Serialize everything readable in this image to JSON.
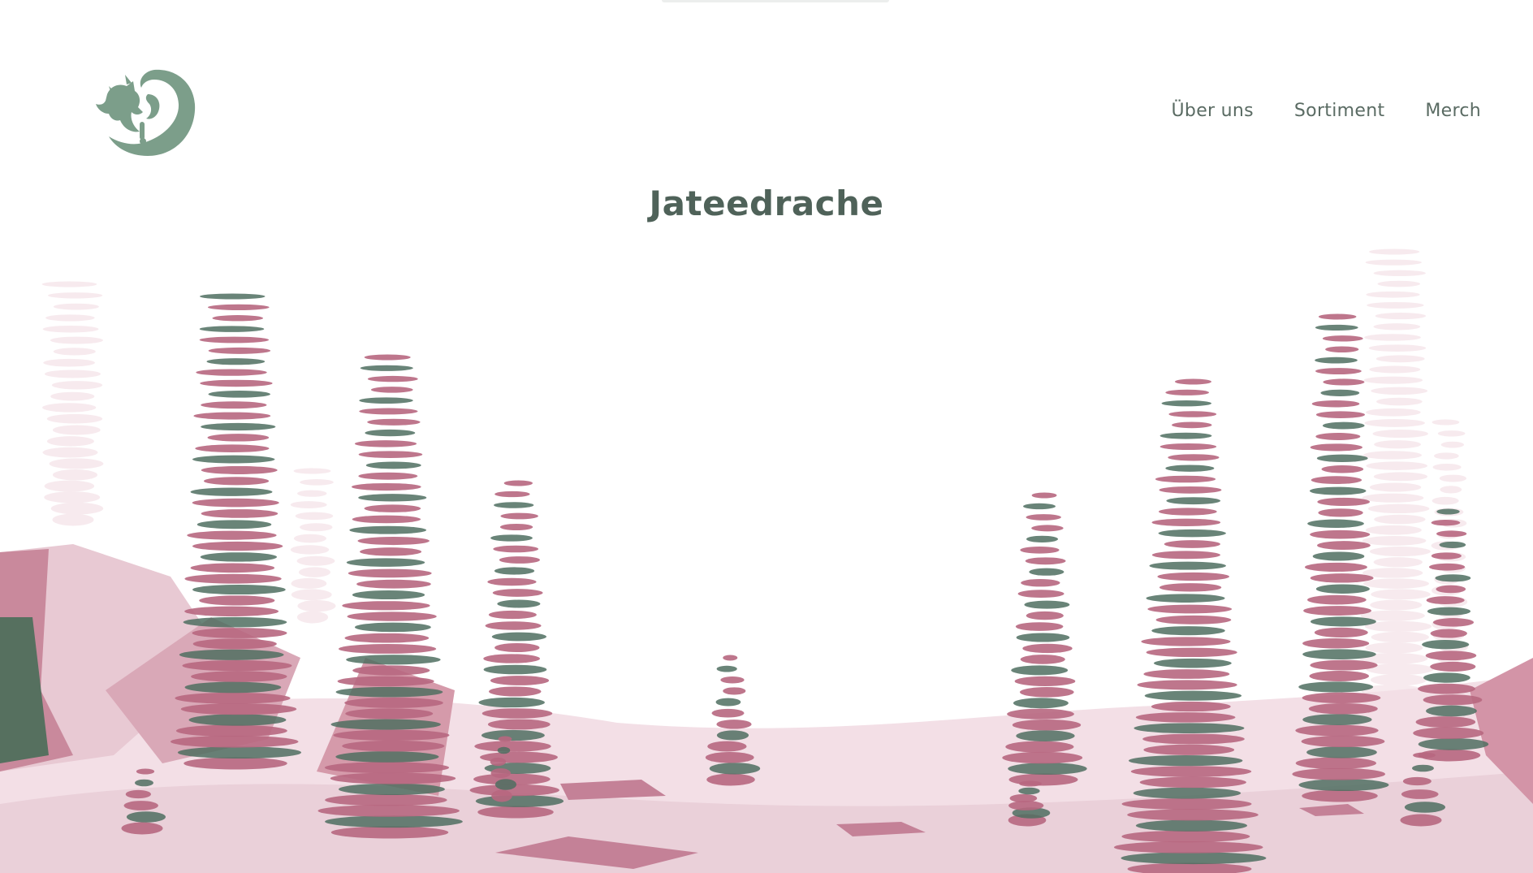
{
  "header": {
    "logo": {
      "icon": "dragon-logo-icon",
      "color": "#7c9e8a"
    },
    "nav": [
      {
        "label": "Über uns"
      },
      {
        "label": "Sortiment"
      },
      {
        "label": "Merch"
      }
    ]
  },
  "hero": {
    "title": "Jateedrache",
    "illustration": "balancing-stone-cairns-illustration"
  },
  "colors": {
    "brand_green": "#7c9e8a",
    "text_green": "#4f6259",
    "stone_pink": "#b7677f",
    "stone_dark": "#4f6f60",
    "ground_pink": "#f3dfe6"
  }
}
